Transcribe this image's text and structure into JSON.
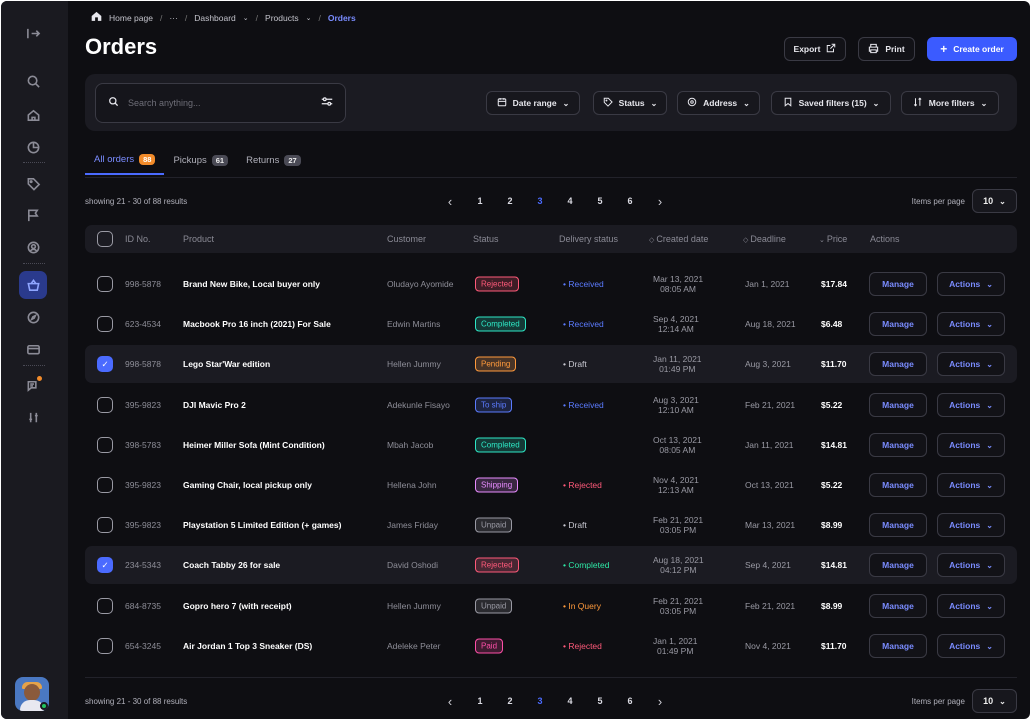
{
  "breadcrumb": {
    "home": "Home page",
    "ellipsis": "···",
    "dashboard": "Dashboard",
    "products": "Products",
    "current": "Orders",
    "sep": "/"
  },
  "page_title": "Orders",
  "header": {
    "export_label": "Export",
    "print_label": "Print",
    "create_label": "Create order"
  },
  "search": {
    "placeholder": "Search anything..."
  },
  "filters": [
    {
      "label": "Date range",
      "icon": "calendar-icon"
    },
    {
      "label": "Status",
      "icon": "tag-icon"
    },
    {
      "label": "Address",
      "icon": "location-pin-icon"
    },
    {
      "label": "Saved filters (15)",
      "icon": "bookmark-icon"
    },
    {
      "label": "More filters",
      "icon": "sort-filter-icon"
    }
  ],
  "tabs": [
    {
      "label": "All orders",
      "count": "88"
    },
    {
      "label": "Pickups",
      "count": "61"
    },
    {
      "label": "Returns",
      "count": "27"
    }
  ],
  "pagination": {
    "showing": "showing 21 - 30 of 88 results",
    "pages": [
      "1",
      "2",
      "3",
      "4",
      "5",
      "6"
    ],
    "current_page": "3",
    "items_per_page_label": "Items per page",
    "items_per_page": "10"
  },
  "columns": {
    "id": "ID No.",
    "product": "Product",
    "customer": "Customer",
    "status": "Status",
    "delivery": "Delivery status",
    "created": "Created date",
    "deadline": "Deadline",
    "price": "Price",
    "actions": "Actions"
  },
  "row_buttons": {
    "manage": "Manage",
    "actions": "Actions"
  },
  "status_colors": {
    "Rejected": "#ff5a7a",
    "Completed": "#2ee8c6",
    "Pending": "#ff9a3c",
    "To ship": "#5b7bff",
    "Shipping": "#e88cff",
    "Unpaid": "#9a9aa4",
    "Paid": "#ff4fa8"
  },
  "delivery_colors": {
    "Received": "#5b7bff",
    "Draft": "#c9c9d2",
    "Rejected": "#ff5a7a",
    "Completed": "#2ee8a6",
    "In Query": "#ff9a3c"
  },
  "rows": [
    {
      "checked": false,
      "id": "998-5878",
      "product": "Brand New Bike, Local buyer only",
      "customer": "Oludayo Ayomide",
      "status": "Rejected",
      "delivery": "Received",
      "created_date": "Mar 13, 2021",
      "created_time": "08:05 AM",
      "deadline": "Jan 1, 2021",
      "price": "$17.84"
    },
    {
      "checked": false,
      "id": "623-4534",
      "product": "Macbook Pro 16 inch (2021) For Sale",
      "customer": "Edwin Martins",
      "status": "Completed",
      "delivery": "Received",
      "created_date": "Sep 4, 2021",
      "created_time": "12:14 AM",
      "deadline": "Aug 18, 2021",
      "price": "$6.48"
    },
    {
      "checked": true,
      "id": "998-5878",
      "product": "Lego Star'War edition",
      "customer": "Hellen Jummy",
      "status": "Pending",
      "delivery": "Draft",
      "created_date": "Jan 11, 2021",
      "created_time": "01:49 PM",
      "deadline": "Aug 3, 2021",
      "price": "$11.70"
    },
    {
      "checked": false,
      "id": "395-9823",
      "product": "DJI Mavic Pro 2",
      "customer": "Adekunle Fisayo",
      "status": "To ship",
      "delivery": "Received",
      "created_date": "Aug 3, 2021",
      "created_time": "12:10 AM",
      "deadline": "Feb 21, 2021",
      "price": "$5.22"
    },
    {
      "checked": false,
      "id": "398-5783",
      "product": "Heimer Miller Sofa (Mint Condition)",
      "customer": "Mbah Jacob",
      "status": "Completed",
      "delivery": "",
      "created_date": "Oct 13, 2021",
      "created_time": "08:05 AM",
      "deadline": "Jan 11, 2021",
      "price": "$14.81"
    },
    {
      "checked": false,
      "id": "395-9823",
      "product": "Gaming Chair, local pickup only",
      "customer": "Hellena John",
      "status": "Shipping",
      "delivery": "Rejected",
      "created_date": "Nov 4, 2021",
      "created_time": "12:13 AM",
      "deadline": "Oct 13, 2021",
      "price": "$5.22"
    },
    {
      "checked": false,
      "id": "395-9823",
      "product": "Playstation 5 Limited Edition (+ games)",
      "customer": "James Friday",
      "status": "Unpaid",
      "delivery": "Draft",
      "created_date": "Feb 21, 2021",
      "created_time": "03:05 PM",
      "deadline": "Mar 13, 2021",
      "price": "$8.99"
    },
    {
      "checked": true,
      "id": "234-5343",
      "product": "Coach Tabby 26 for sale",
      "customer": "David Oshodi",
      "status": "Rejected",
      "delivery": "Completed",
      "created_date": "Aug 18, 2021",
      "created_time": "04:12 PM",
      "deadline": "Sep 4, 2021",
      "price": "$14.81"
    },
    {
      "checked": false,
      "id": "684-8735",
      "product": "Gopro hero 7 (with receipt)",
      "customer": "Hellen Jummy",
      "status": "Unpaid",
      "delivery": "In Query",
      "created_date": "Feb 21, 2021",
      "created_time": "03:05 PM",
      "deadline": "Feb 21, 2021",
      "price": "$8.99"
    },
    {
      "checked": false,
      "id": "654-3245",
      "product": "Air Jordan 1 Top 3 Sneaker (DS)",
      "customer": "Adeleke Peter",
      "status": "Paid",
      "delivery": "Rejected",
      "created_date": "Jan 1, 2021",
      "created_time": "01:49 PM",
      "deadline": "Nov 4, 2021",
      "price": "$11.70"
    }
  ]
}
